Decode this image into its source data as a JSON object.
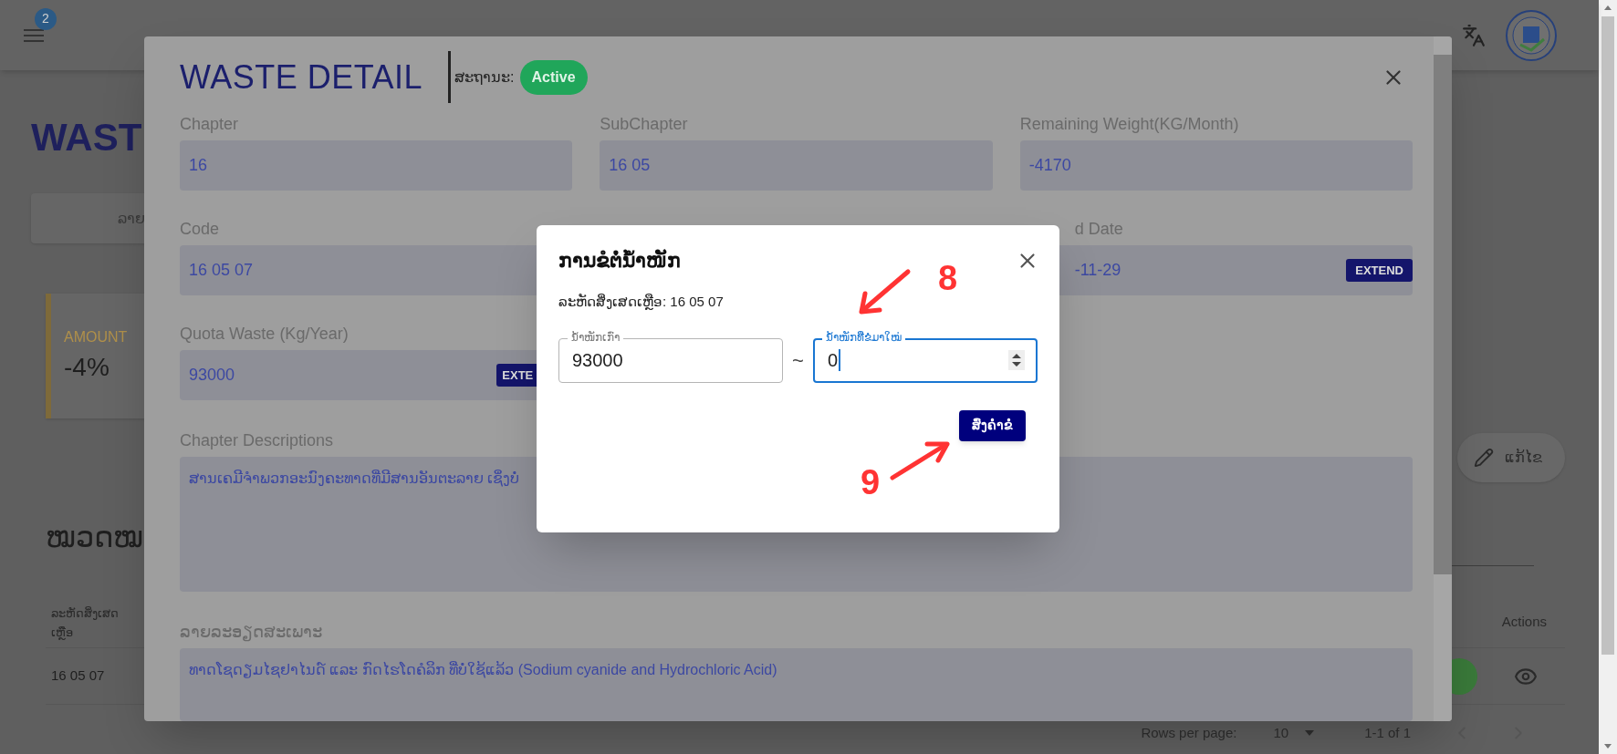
{
  "app_bar": {
    "notification_count": "2"
  },
  "page": {
    "title": "WAST",
    "tab": "ລາຍ",
    "amount_card": {
      "label": "AMOUNT",
      "value": "-4%"
    },
    "edit_button": "ແກ້ໄຂ",
    "section_title": "ໝວດໝ",
    "table": {
      "columns": [
        "ລະຫັດສິ່ງເສດເຫຼືອ",
        "Actions"
      ],
      "rows": [
        {
          "code": "16 05 07"
        }
      ]
    },
    "pagination": {
      "rows_per_page_label": "Rows per page:",
      "rows_per_page": "10",
      "range": "1-1 of 1"
    }
  },
  "detail_modal": {
    "title": "WASTE DETAIL",
    "status_label": "ສະຖານະ:",
    "status": "Active",
    "fields": [
      {
        "label": "Chapter",
        "value": "16"
      },
      {
        "label": "SubChapter",
        "value": "16 05"
      },
      {
        "label": "Remaining Weight(KG/Month)",
        "value": "-4170"
      },
      {
        "label": "Code",
        "value": "16 05 07"
      },
      {
        "label": "d Date",
        "value": "-11-29",
        "action": "EXTEND"
      },
      {
        "label": "Quota Waste (Kg/Year)",
        "value": "93000",
        "action": "EXTE"
      }
    ],
    "wide_fields": [
      {
        "label": "Chapter Descriptions",
        "value": "ສານເຄມີຈຳພວກອະນົງຄະທາດທີ່ມີສານອັນຕະລາຍ ເຊິ່ງບໍ່"
      },
      {
        "label": "ລາຍລະອຽດສະເພາະ",
        "value": "ທາດໂຊດຽມໄຊຢາໄນດ໌ ແລະ ກົດໄຮໂດຄໍລິກ ທີ່ບໍ່ໃຊ້ແລ້ວ (Sodium cyanide and Hydrochloric Acid)"
      }
    ]
  },
  "dialog": {
    "title": "ການຂໍຕໍ່ນ້ຳໜັກ",
    "code_line": "ລະຫັດສິ່ງເສດເຫຼືອ: 16 05 07",
    "fields": [
      {
        "label": "ນ້ຳໜັກເກົ່າ",
        "value": "93000",
        "focused": false
      },
      {
        "label": "ນ້ຳໜັກທີ່ຂໍມາໃໝ່",
        "value": "0",
        "focused": true
      }
    ],
    "separator": "~",
    "submit": "ສົ່ງຄຳຂໍ"
  },
  "annotations": [
    {
      "text": "8"
    },
    {
      "text": "9"
    }
  ]
}
